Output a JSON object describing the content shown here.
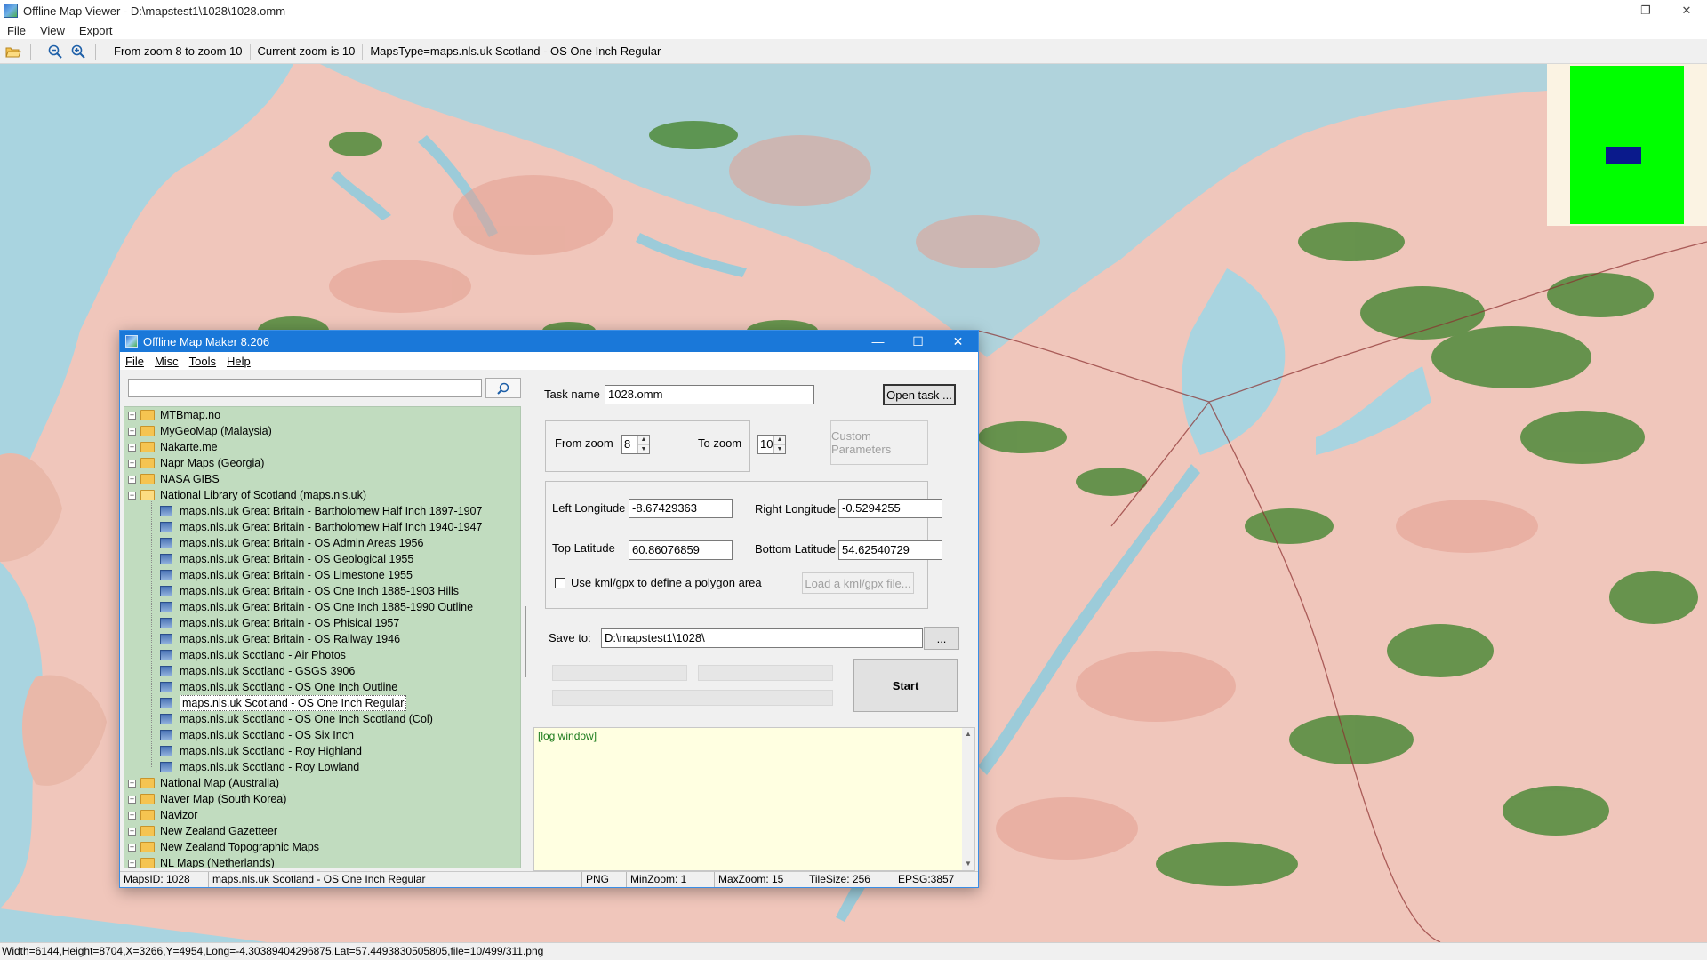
{
  "viewer": {
    "title": "Offline Map Viewer - D:\\mapstest1\\1028\\1028.omm",
    "menu": [
      "File",
      "View",
      "Export"
    ],
    "toolbar": {
      "zoom_range": "From zoom 8 to zoom 10",
      "current_zoom": "Current zoom is 10",
      "maps_type": "MapsType=maps.nls.uk Scotland - OS One Inch Regular"
    },
    "status": "Width=6144,Height=8704,X=3266,Y=4954,Long=-4.30389404296875,Lat=57.4493830505805,file=10/499/311.png"
  },
  "dialog": {
    "title": "Offline Map Maker 8.206",
    "menu": [
      "File",
      "Misc",
      "Tools",
      "Help"
    ],
    "search": {
      "value": "",
      "placeholder": ""
    },
    "tree": {
      "folders_before": [
        "MTBmap.no",
        "MyGeoMap (Malaysia)",
        "Nakarte.me",
        "Napr Maps (Georgia)",
        "NASA GIBS"
      ],
      "open_folder": "National Library of Scotland (maps.nls.uk)",
      "items": [
        "maps.nls.uk Great Britain - Bartholomew Half Inch 1897-1907",
        "maps.nls.uk Great Britain - Bartholomew Half Inch 1940-1947",
        "maps.nls.uk Great Britain - OS Admin Areas 1956",
        "maps.nls.uk Great Britain - OS Geological 1955",
        "maps.nls.uk Great Britain - OS Limestone 1955",
        "maps.nls.uk Great Britain - OS One Inch 1885-1903 Hills",
        "maps.nls.uk Great Britain - OS One Inch 1885-1990 Outline",
        "maps.nls.uk Great Britain - OS Phisical 1957",
        "maps.nls.uk Great Britain - OS Railway 1946",
        "maps.nls.uk Scotland - Air Photos",
        "maps.nls.uk Scotland - GSGS 3906",
        "maps.nls.uk Scotland - OS One Inch Outline",
        "maps.nls.uk Scotland - OS One Inch Regular",
        "maps.nls.uk Scotland - OS One Inch Scotland (Col)",
        "maps.nls.uk Scotland - OS Six Inch",
        "maps.nls.uk Scotland - Roy Highland",
        "maps.nls.uk Scotland - Roy Lowland"
      ],
      "selected_index": 12,
      "folders_after": [
        "National Map (Australia)",
        "Naver Map (South Korea)",
        "Navizor",
        "New Zealand Gazetteer",
        "New Zealand Topographic Maps",
        "NL Maps (Netherlands)"
      ]
    },
    "form": {
      "task_name_label": "Task name",
      "task_name_value": "1028.omm",
      "open_task_label": "Open task ...",
      "from_zoom_label": "From zoom",
      "from_zoom_value": "8",
      "to_zoom_label": "To zoom",
      "to_zoom_value": "10",
      "custom_params_label": "Custom Parameters",
      "left_lon_label": "Left Longitude",
      "left_lon_value": "-8.67429363",
      "right_lon_label": "Right Longitude",
      "right_lon_value": "-0.5294255",
      "top_lat_label": "Top Latitude",
      "top_lat_value": "60.86076859",
      "bottom_lat_label": "Bottom Latitude",
      "bottom_lat_value": "54.62540729",
      "kml_checkbox_label": "Use kml/gpx to define a polygon area",
      "load_kml_label": "Load a kml/gpx file...",
      "save_to_label": "Save to:",
      "save_to_value": "D:\\mapstest1\\1028\\",
      "browse_label": "...",
      "start_label": "Start"
    },
    "log": "[log window]",
    "status": {
      "maps_id": "MapsID: 1028",
      "maps_name": "maps.nls.uk Scotland - OS One Inch Regular",
      "format": "PNG",
      "min_zoom": "MinZoom: 1",
      "max_zoom": "MaxZoom: 15",
      "tile_size": "TileSize: 256",
      "epsg": "EPSG:3857"
    }
  },
  "colors": {
    "sea": "#a9d4e0",
    "land": "#f0c6bb",
    "forest": "#4f8a3a",
    "tree_bg": "#c1dcbf",
    "overview_green": "#00ff00"
  }
}
